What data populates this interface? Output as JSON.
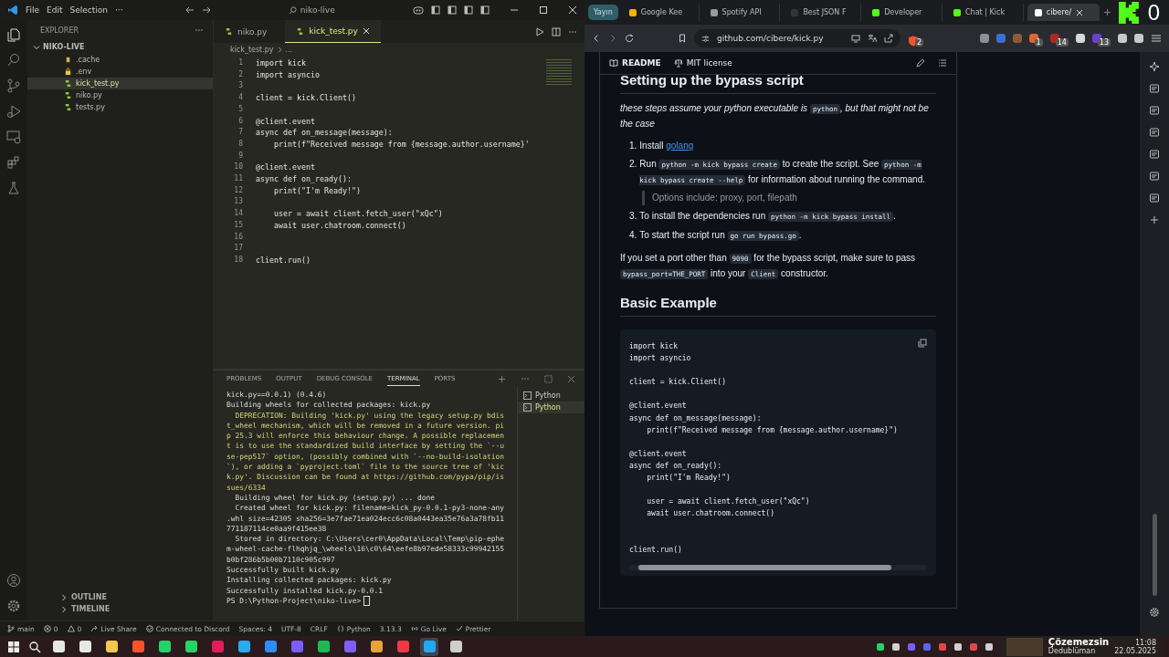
{
  "vscode": {
    "menu": [
      "File",
      "Edit",
      "Selection",
      "···"
    ],
    "search": "niko-live",
    "explorer": {
      "title": "EXPLORER",
      "folder": "NIKO-LIVE",
      "expanded": true,
      "files": [
        {
          "name": ".cache",
          "kind": "cache",
          "selected": false
        },
        {
          "name": ".env",
          "kind": "lock",
          "selected": false
        },
        {
          "name": "kick_test.py",
          "kind": "python",
          "selected": true
        },
        {
          "name": "niko.py",
          "kind": "python",
          "selected": false
        },
        {
          "name": "tests.py",
          "kind": "python",
          "selected": false
        }
      ],
      "sections": [
        "OUTLINE",
        "TIMELINE"
      ]
    },
    "tabs": [
      {
        "label": "niko.py",
        "selected": false
      },
      {
        "label": "kick_test.py",
        "selected": true
      }
    ],
    "breadcrumb": [
      "kick_test.py",
      "..."
    ],
    "line_numbers": [
      "1",
      "2",
      "3",
      "4",
      "5",
      "6",
      "7",
      "8",
      "9",
      "10",
      "11",
      "12",
      "13",
      "14",
      "15",
      "16",
      "17",
      "18"
    ],
    "code": "import kick\nimport asyncio\n\nclient = kick.Client()\n\n@client.event\nasync def on_message(message):\n    print(f\"Received message from {message.author.username}'\n\n@client.event\nasync def on_ready():\n    print(\"I'm Ready!\")\n\n    user = await client.fetch_user(\"xQc\")\n    await user.chatroom.connect()\n\n\nclient.run()",
    "panel": {
      "tabs": [
        {
          "label": "PROBLEMS",
          "selected": false
        },
        {
          "label": "OUTPUT",
          "selected": false
        },
        {
          "label": "DEBUG CONSOLE",
          "selected": false
        },
        {
          "label": "TERMINAL",
          "selected": true
        },
        {
          "label": "PORTS",
          "selected": false
        }
      ],
      "terminal": [
        {
          "text": "kick.py==0.0.1) (0.4.6)",
          "kind": "plain"
        },
        {
          "text": "Building wheels for collected packages: kick.py",
          "kind": "plain"
        },
        {
          "text": "  DEPRECATION: Building 'kick.py' using the legacy setup.py bdis",
          "kind": "warn"
        },
        {
          "text": "t_wheel mechanism, which will be removed in a future version. pi",
          "kind": "warn"
        },
        {
          "text": "p 25.3 will enforce this behaviour change. A possible replacemen",
          "kind": "warn"
        },
        {
          "text": "t is to use the standardized build interface by setting the `--u",
          "kind": "warn"
        },
        {
          "text": "se-pep517` option, (possibly combined with `--no-build-isolation",
          "kind": "warn"
        },
        {
          "text": "`), or adding a `pyproject.toml` file to the source tree of 'kic",
          "kind": "warn"
        },
        {
          "text": "k.py'. Discussion can be found at https://github.com/pypa/pip/is",
          "kind": "warn"
        },
        {
          "text": "sues/6334",
          "kind": "warn"
        },
        {
          "text": "  Building wheel for kick.py (setup.py) ... done",
          "kind": "plain"
        },
        {
          "text": "  Created wheel for kick.py: filename=kick_py-0.0.1-py3-none-any",
          "kind": "plain"
        },
        {
          "text": ".whl size=42305 sha256=3e7fae71ea024ecc6c08a0443ea35e76a3a78fb11",
          "kind": "plain"
        },
        {
          "text": "771187114ce0aa9f415ee38",
          "kind": "plain"
        },
        {
          "text": "  Stored in directory: C:\\Users\\cer0\\AppData\\Local\\Temp\\pip-ephe",
          "kind": "plain"
        },
        {
          "text": "m-wheel-cache-flhqhjq_\\wheels\\16\\c0\\64\\eefe8b97ede58333c99942155",
          "kind": "plain"
        },
        {
          "text": "b0bf286b5b00b7110c905c997",
          "kind": "plain"
        },
        {
          "text": "Successfully built kick.py",
          "kind": "plain"
        },
        {
          "text": "Installing collected packages: kick.py",
          "kind": "plain"
        },
        {
          "text": "Successfully installed kick.py-0.0.1",
          "kind": "plain"
        },
        {
          "text": "PS D:\\Python-Project\\niko-live>",
          "kind": "prompt"
        }
      ],
      "shells": [
        {
          "label": "Python",
          "selected": false
        },
        {
          "label": "Python",
          "selected": true
        }
      ]
    },
    "status": [
      {
        "text": "main",
        "kind": "branch"
      },
      {
        "text": "0",
        "kind": "error"
      },
      {
        "text": "0",
        "kind": "warning"
      },
      {
        "text": "Live Share",
        "kind": "share"
      },
      {
        "text": "Connected to Discord",
        "kind": "discord"
      },
      {
        "text": "Spaces: 4",
        "kind": "plain"
      },
      {
        "text": "UTF-8",
        "kind": "plain"
      },
      {
        "text": "CRLF",
        "kind": "plain"
      },
      {
        "text": "Python",
        "kind": "language"
      },
      {
        "text": "3.13.3",
        "kind": "plain"
      },
      {
        "text": "Go Live",
        "kind": "live"
      },
      {
        "text": "Prettier",
        "kind": "formatter"
      }
    ]
  },
  "browser": {
    "badge": "Yayın",
    "overlay_count": "0",
    "tabs": [
      {
        "label": "Google Kee",
        "selected": false,
        "color": "#f4b400"
      },
      {
        "label": "Spotify API",
        "selected": false,
        "color": "#9a9a9a"
      },
      {
        "label": "Best JSON F",
        "selected": false,
        "color": "#333333"
      },
      {
        "label": "Developer",
        "selected": false,
        "color": "#53fc18"
      },
      {
        "label": "Chat | Kick",
        "selected": false,
        "color": "#53fc18"
      },
      {
        "label": "cibere/",
        "selected": true,
        "color": "#ffffff"
      }
    ],
    "url": "github.com/cibere/kick.py",
    "shield_badge": "2",
    "extensions": [
      {
        "color": "#8a8f98"
      },
      {
        "color": "#3b6fd6"
      },
      {
        "color": "#8b5a3c"
      },
      {
        "color": "#e0662f",
        "badge": "1"
      },
      {
        "color": "#b3261e",
        "badge": "14"
      },
      {
        "color": "#d8d8d8"
      },
      {
        "color": "#6b3fd6",
        "badge": "13"
      },
      {
        "color": "#c9c9c9"
      },
      {
        "color": "#c9c9c9"
      }
    ],
    "readme": {
      "tabs": [
        "README",
        "MIT license"
      ],
      "heading": "Setting up the bypass script",
      "intro": [
        {
          "kind": "text",
          "text": "these steps assume your python executable is "
        },
        {
          "kind": "code",
          "text": "python"
        },
        {
          "kind": "text",
          "text": ", but that might not be the case"
        }
      ],
      "steps": [
        {
          "number": "1.",
          "segments": [
            {
              "kind": "text",
              "text": "Install "
            },
            {
              "kind": "link",
              "text": "golang"
            }
          ]
        },
        {
          "number": "2.",
          "segments": [
            {
              "kind": "text",
              "text": "Run "
            },
            {
              "kind": "code",
              "text": "python -m kick bypass create"
            },
            {
              "kind": "text",
              "text": " to create the script. See "
            },
            {
              "kind": "code",
              "text": "python -m kick bypass create --help"
            },
            {
              "kind": "text",
              "text": " for information about running the command."
            }
          ],
          "quote": "Options include: proxy, port, filepath"
        },
        {
          "number": "3.",
          "segments": [
            {
              "kind": "text",
              "text": "To install the dependencies run "
            },
            {
              "kind": "code",
              "text": "python -m kick bypass install"
            },
            {
              "kind": "text",
              "text": "."
            }
          ]
        },
        {
          "number": "4.",
          "segments": [
            {
              "kind": "text",
              "text": "To start the script run "
            },
            {
              "kind": "code",
              "text": "go run bypass.go"
            },
            {
              "kind": "text",
              "text": "."
            }
          ]
        }
      ],
      "note": [
        {
          "kind": "text",
          "text": "If you set a port other than "
        },
        {
          "kind": "code",
          "text": "9090"
        },
        {
          "kind": "text",
          "text": " for the bypass script, make sure to pass "
        },
        {
          "kind": "code",
          "text": "bypass_port=THE_PORT"
        },
        {
          "kind": "text",
          "text": " into your "
        },
        {
          "kind": "code",
          "text": "Client"
        },
        {
          "kind": "text",
          "text": " constructor."
        }
      ],
      "heading2": "Basic Example",
      "code": "import kick\nimport asyncio\n\nclient = kick.Client()\n\n@client.event\nasync def on_message(message):\n    print(f\"Received message from {message.author.username}\")\n\n@client.event\nasync def on_ready():\n    print(\"I'm Ready!\")\n\n    user = await client.fetch_user(\"xQc\")\n    await user.chatroom.connect()\n\n\nclient.run()"
    }
  },
  "taskbar": {
    "apps": [
      {
        "color": "#e8e8e8",
        "selected": false
      },
      {
        "color": "#e8e8e8",
        "selected": false
      },
      {
        "color": "#f2c94c",
        "selected": false
      },
      {
        "color": "#fb542b",
        "selected": false
      },
      {
        "color": "#25d366",
        "selected": false
      },
      {
        "color": "#25d366",
        "selected": false
      },
      {
        "color": "#e01e5a",
        "selected": false
      },
      {
        "color": "#2aabee",
        "selected": false
      },
      {
        "color": "#2d8cff",
        "selected": false
      },
      {
        "color": "#7b5cff",
        "selected": false
      },
      {
        "color": "#1db954",
        "selected": false
      },
      {
        "color": "#7d5fff",
        "selected": false
      },
      {
        "color": "#e8a33d",
        "selected": false
      },
      {
        "color": "#f03a47",
        "selected": false
      },
      {
        "color": "#23a9f2",
        "selected": true
      },
      {
        "color": "#cfcfcf",
        "selected": false
      }
    ],
    "tray": [
      {
        "color": "#25d366"
      },
      {
        "color": "#d0d0d0"
      },
      {
        "color": "#7b5cff"
      },
      {
        "color": "#5865f2"
      },
      {
        "color": "#e04848"
      },
      {
        "color": "#d0d0d0"
      },
      {
        "color": "#e04848"
      },
      {
        "color": "#d0d0d0"
      }
    ],
    "media": {
      "title": "Çözemezsin",
      "artist": "Dedublüman"
    },
    "time": "11:08",
    "date": "22.05.2025"
  }
}
